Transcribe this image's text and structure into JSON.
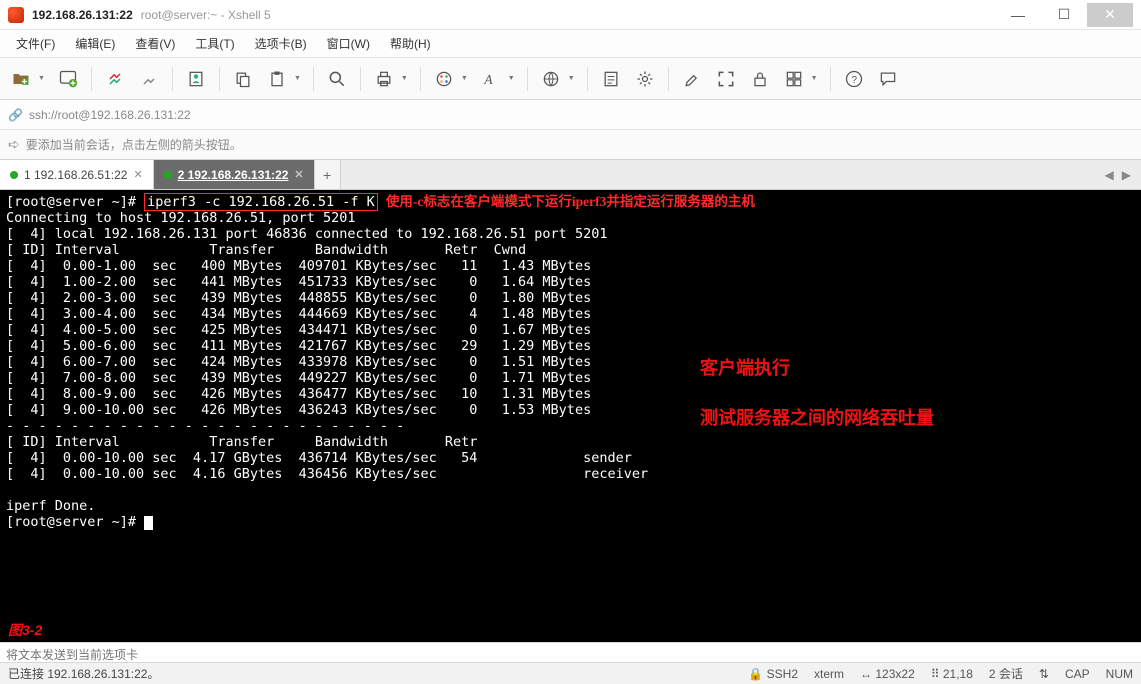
{
  "title": {
    "main": "192.168.26.131:22",
    "sub": "root@server:~ - Xshell 5"
  },
  "menu": [
    "文件(F)",
    "编辑(E)",
    "查看(V)",
    "工具(T)",
    "选项卡(B)",
    "窗口(W)",
    "帮助(H)"
  ],
  "address": {
    "url": "ssh://root@192.168.26.131:22"
  },
  "hint": "要添加当前会话，点击左侧的箭头按钮。",
  "tabs": [
    {
      "label": "1 192.168.26.51:22",
      "active": false
    },
    {
      "label": "2 192.168.26.131:22",
      "active": true
    }
  ],
  "terminal": {
    "prompt": "[root@server ~]# ",
    "cmd": "iperf3 -c 192.168.26.51 -f K",
    "cmd_note": "使用-c标志在客户端模式下运行iperf3并指定运行服务器的主机",
    "connecting": "Connecting to host 192.168.26.51, port 5201",
    "local": "[  4] local 192.168.26.131 port 46836 connected to 192.168.26.51 port 5201",
    "hdr": "[ ID] Interval           Transfer     Bandwidth       Retr  Cwnd",
    "rows": [
      {
        "id": "4",
        "interval": "0.00-1.00",
        "unit": "sec",
        "transfer": "400 MBytes",
        "bandwidth": "409701 KBytes/sec",
        "retr": "11",
        "cwnd": "1.43 MBytes"
      },
      {
        "id": "4",
        "interval": "1.00-2.00",
        "unit": "sec",
        "transfer": "441 MBytes",
        "bandwidth": "451733 KBytes/sec",
        "retr": "0",
        "cwnd": "1.64 MBytes"
      },
      {
        "id": "4",
        "interval": "2.00-3.00",
        "unit": "sec",
        "transfer": "439 MBytes",
        "bandwidth": "448855 KBytes/sec",
        "retr": "0",
        "cwnd": "1.80 MBytes"
      },
      {
        "id": "4",
        "interval": "3.00-4.00",
        "unit": "sec",
        "transfer": "434 MBytes",
        "bandwidth": "444669 KBytes/sec",
        "retr": "4",
        "cwnd": "1.48 MBytes"
      },
      {
        "id": "4",
        "interval": "4.00-5.00",
        "unit": "sec",
        "transfer": "425 MBytes",
        "bandwidth": "434471 KBytes/sec",
        "retr": "0",
        "cwnd": "1.67 MBytes"
      },
      {
        "id": "4",
        "interval": "5.00-6.00",
        "unit": "sec",
        "transfer": "411 MBytes",
        "bandwidth": "421767 KBytes/sec",
        "retr": "29",
        "cwnd": "1.29 MBytes"
      },
      {
        "id": "4",
        "interval": "6.00-7.00",
        "unit": "sec",
        "transfer": "424 MBytes",
        "bandwidth": "433978 KBytes/sec",
        "retr": "0",
        "cwnd": "1.51 MBytes"
      },
      {
        "id": "4",
        "interval": "7.00-8.00",
        "unit": "sec",
        "transfer": "439 MBytes",
        "bandwidth": "449227 KBytes/sec",
        "retr": "0",
        "cwnd": "1.71 MBytes"
      },
      {
        "id": "4",
        "interval": "8.00-9.00",
        "unit": "sec",
        "transfer": "426 MBytes",
        "bandwidth": "436477 KBytes/sec",
        "retr": "10",
        "cwnd": "1.31 MBytes"
      },
      {
        "id": "4",
        "interval": "9.00-10.00",
        "unit": "sec",
        "transfer": "426 MBytes",
        "bandwidth": "436243 KBytes/sec",
        "retr": "0",
        "cwnd": "1.53 MBytes"
      }
    ],
    "dashes": "- - - - - - - - - - - - - - - - - - - - - - - - -",
    "sum_hdr": "[ ID] Interval           Transfer     Bandwidth       Retr",
    "summary": [
      {
        "id": "4",
        "interval": "0.00-10.00",
        "unit": "sec",
        "transfer": "4.17 GBytes",
        "bandwidth": "436714 KBytes/sec",
        "retr": "54",
        "role": "sender"
      },
      {
        "id": "4",
        "interval": "0.00-10.00",
        "unit": "sec",
        "transfer": "4.16 GBytes",
        "bandwidth": "436456 KBytes/sec",
        "retr": "",
        "role": "receiver"
      }
    ],
    "done": "iperf Done.",
    "ann1": "客户端执行",
    "ann2": "测试服务器之间的网络吞吐量"
  },
  "fig": "图3-2",
  "input_placeholder": "将文本发送到当前选项卡",
  "status": {
    "left": "已连接 192.168.26.131:22。",
    "lock": "SSH2",
    "term": "xterm",
    "size": "123x22",
    "pos": "21,18",
    "sessions": "2 会话",
    "cap": "CAP",
    "num": "NUM"
  }
}
